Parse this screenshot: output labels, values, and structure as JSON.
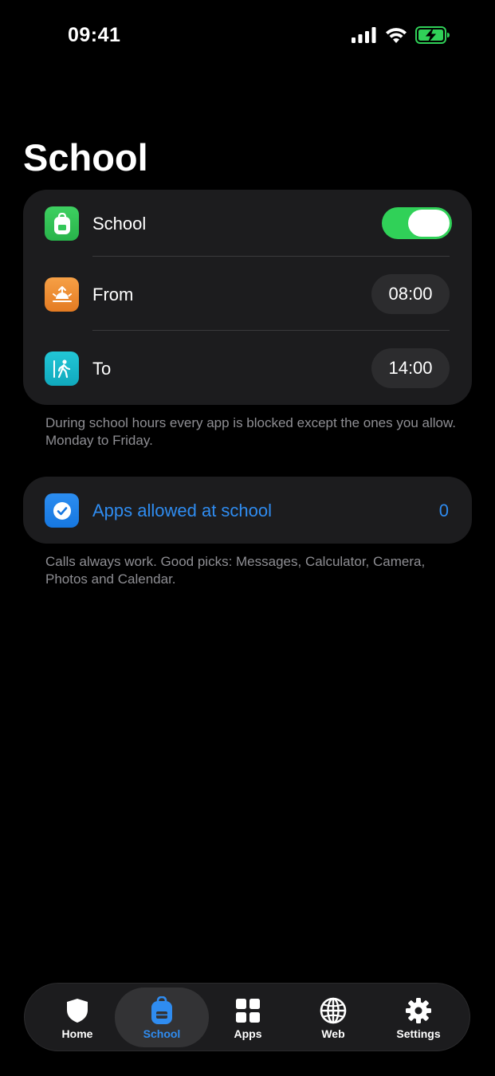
{
  "status_bar": {
    "time": "09:41",
    "icons": [
      "cellular-signal-icon",
      "wifi-icon",
      "battery-charging-icon"
    ]
  },
  "page": {
    "title": "School"
  },
  "schedule": {
    "school_row": {
      "label": "School",
      "icon": "backpack-icon",
      "toggle_on": true,
      "toggle_color": "#30d158"
    },
    "from_row": {
      "label": "From",
      "icon": "sunrise-icon",
      "value": "08:00"
    },
    "to_row": {
      "label": "To",
      "icon": "walking-person-icon",
      "value": "14:00"
    },
    "footnote": "During school hours every app is blocked except the ones you allow. Monday to Friday."
  },
  "allowed_apps": {
    "label": "Apps allowed at school",
    "icon": "checkmark-circle-icon",
    "count": "0",
    "footnote": "Calls always work. Good picks: Messages, Calculator, Camera, Photos and Calendar.",
    "accent_color": "#2f8cf0"
  },
  "tab_bar": {
    "active": "School",
    "tabs": [
      {
        "label": "Home",
        "icon": "shield-icon"
      },
      {
        "label": "School",
        "icon": "backpack-icon"
      },
      {
        "label": "Apps",
        "icon": "grid-icon"
      },
      {
        "label": "Web",
        "icon": "globe-icon"
      },
      {
        "label": "Settings",
        "icon": "gear-icon"
      }
    ]
  }
}
